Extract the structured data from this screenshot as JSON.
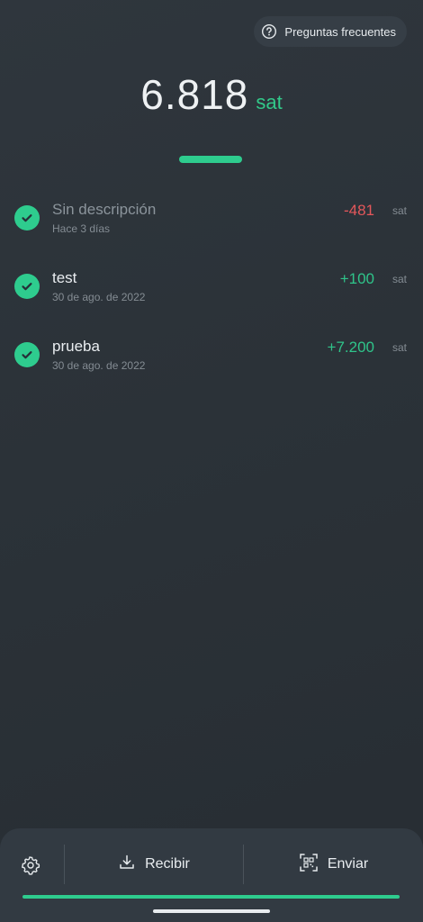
{
  "header": {
    "faq_label": "Preguntas frecuentes",
    "faq_icon": "help-circle-icon"
  },
  "balance": {
    "amount": "6.818",
    "unit": "sat"
  },
  "transactions": [
    {
      "title": "Sin descripción",
      "date": "Hace 3 días",
      "amount": "-481",
      "unit": "sat",
      "status_icon": "check-circle-icon"
    },
    {
      "title": "test",
      "date": "30 de ago. de 2022",
      "amount": "+100",
      "unit": "sat",
      "status_icon": "check-circle-icon"
    },
    {
      "title": "prueba",
      "date": "30 de ago. de 2022",
      "amount": "+7.200",
      "unit": "sat",
      "status_icon": "check-circle-icon"
    }
  ],
  "bottom_bar": {
    "settings_icon": "gear-icon",
    "receive_label": "Recibir",
    "receive_icon": "download-icon",
    "send_label": "Enviar",
    "send_icon": "qr-scan-icon"
  },
  "colors": {
    "accent": "#2ecc8e",
    "negative": "#e4575b",
    "background": "#2d343a"
  }
}
